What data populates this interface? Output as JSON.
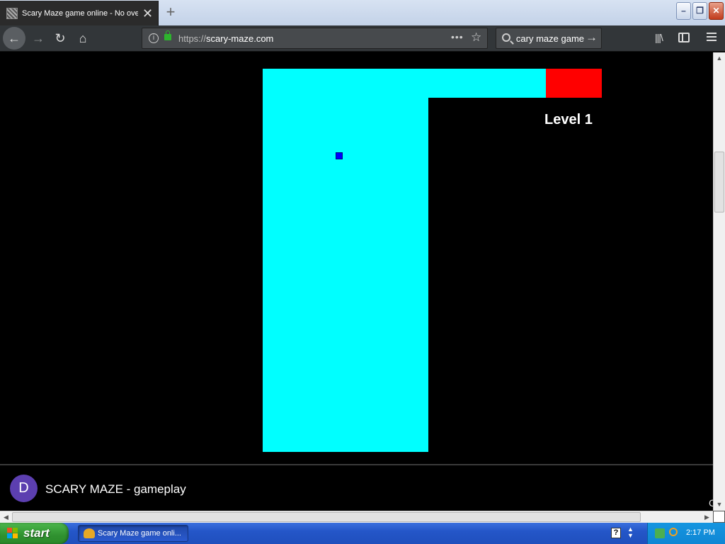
{
  "browser": {
    "tab": {
      "title": "Scary Maze game online - No over",
      "close": "✕"
    },
    "new_tab": "+",
    "window": {
      "minimize": "–",
      "restore": "❐",
      "close": "✕"
    },
    "nav": {
      "back": "←",
      "forward": "→",
      "reload": "↻",
      "home": "⌂"
    },
    "url": {
      "prefix": "https://",
      "host": "scary-maze.com",
      "info": "i",
      "page_actions": "•••",
      "bookmark": "☆"
    },
    "search": {
      "text": "scary maze game",
      "go": "→"
    },
    "library": "|||\\"
  },
  "game": {
    "level_label": "Level 1",
    "colors": {
      "path": "#00ffff",
      "goal": "#ff0000",
      "player": "#0000ff",
      "background": "#000000"
    }
  },
  "video_bar": {
    "avatar_letter": "D",
    "title": "SCARY MAZE - gameplay",
    "corner_char": "C"
  },
  "scrollbars": {
    "up": "▲",
    "down": "▼",
    "left": "◀",
    "right": "▶"
  },
  "taskbar": {
    "start_label": "start",
    "task_label": "Scary Maze game onli...",
    "help": "?",
    "clock": "2:17 PM"
  }
}
